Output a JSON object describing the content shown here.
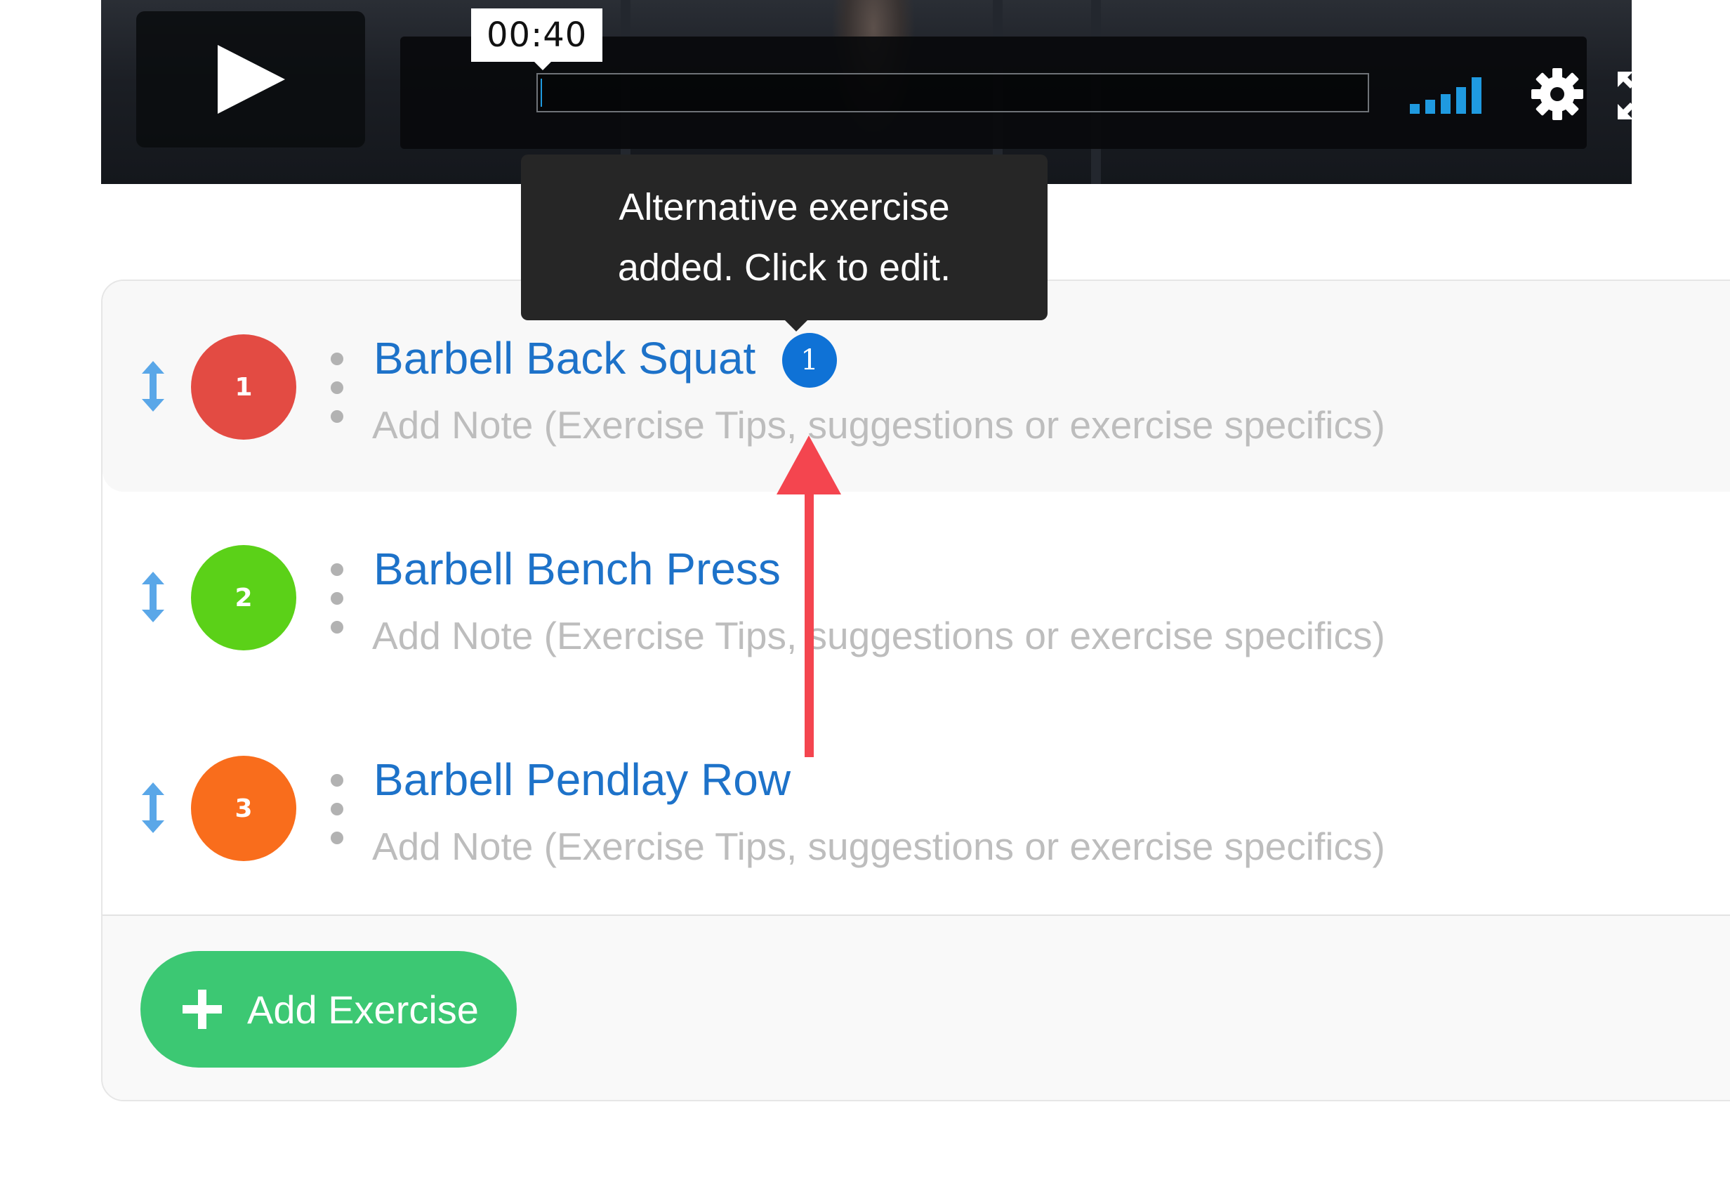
{
  "video": {
    "time": "00:40",
    "progress": 0.0
  },
  "tooltip": {
    "line1": "Alternative exercise",
    "line2": "added. Click to edit."
  },
  "exercises": [
    {
      "number": "1",
      "name": "Barbell Back Squat",
      "alternatives_badge": "1",
      "note_placeholder": "Add Note (Exercise Tips, suggestions or exercise specifics)",
      "color": "#e34b43"
    },
    {
      "number": "2",
      "name": "Barbell Bench Press",
      "note_placeholder": "Add Note (Exercise Tips, suggestions or exercise specifics)",
      "color": "#5bd118"
    },
    {
      "number": "3",
      "name": "Barbell Pendlay Row",
      "note_placeholder": "Add Note (Exercise Tips, suggestions or exercise specifics)",
      "color": "#f96d1c"
    }
  ],
  "add_exercise": {
    "label": "Add Exercise"
  },
  "colors": {
    "link_blue": "#1d72c9",
    "badge_blue": "#0f72d6",
    "add_green": "#3cc873",
    "annotation_red": "#f4454f",
    "drag_blue": "#5aa7e8"
  }
}
